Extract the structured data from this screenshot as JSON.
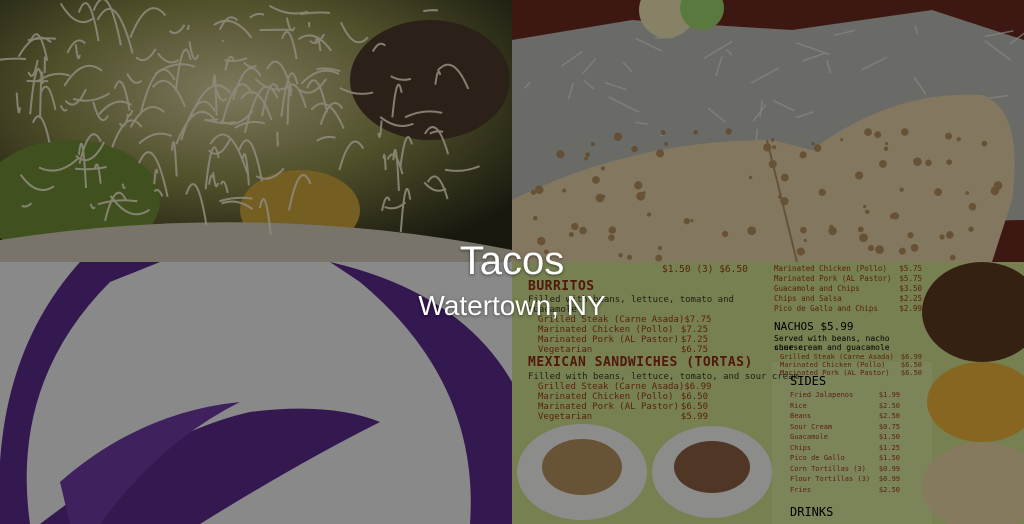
{
  "hero": {
    "title": "Tacos",
    "subtitle": "Watertown, NY"
  },
  "images": [
    {
      "name": "taco-salad-photo"
    },
    {
      "name": "burrito-foil-photo"
    },
    {
      "name": "taco-bell-logo-photo"
    },
    {
      "name": "menu-board-photo"
    }
  ],
  "menu": {
    "top_line": {
      "label": "",
      "price": "$1.50   (3) $6.50"
    },
    "burritos": {
      "heading": "BURRITOS",
      "desc": "Filled with beans, lettuce, tomato and",
      "desc2": "guacamole",
      "items": [
        {
          "label": "Grilled Steak (Carne Asada)",
          "price": "$7.75"
        },
        {
          "label": "Marinated Chicken (Pollo)",
          "price": "$7.25"
        },
        {
          "label": "Marinated Pork (AL Pastor)",
          "price": "$7.25"
        },
        {
          "label": "Vegetarian",
          "price": "$6.75"
        }
      ]
    },
    "tortas": {
      "heading": "MEXICAN SANDWICHES (TORTAS)",
      "desc": "Filled with beans, lettuce, tomato, and sour cream",
      "items": [
        {
          "label": "Grilled Steak (Carne Asada)",
          "price": "$6.99"
        },
        {
          "label": "Marinated Chicken (Pollo)",
          "price": "$6.50"
        },
        {
          "label": "Marinated Pork (AL Pastor)",
          "price": "$6.50"
        },
        {
          "label": "Vegetarian",
          "price": "$5.99"
        }
      ]
    },
    "right_top": [
      {
        "label": "Marinated Chicken (Pollo)",
        "price": "$5.75"
      },
      {
        "label": "Marinated Pork (AL Pastor)",
        "price": "$5.75"
      },
      {
        "label": "Guacamole and Chips",
        "price": "$3.50"
      },
      {
        "label": "Chips and Salsa",
        "price": "$2.25"
      },
      {
        "label": "Pico de Gallo and Chips",
        "price": "$2.99"
      }
    ],
    "nachos": {
      "heading": "NACHOS $5.99",
      "desc": "Served with beans, nacho cheese,",
      "desc2": "sour cream and guacamole",
      "items": [
        {
          "label": "Grilled Steak (Carne Asada)",
          "price": "$6.99"
        },
        {
          "label": "Marinated Chicken (Pollo)",
          "price": "$6.50"
        },
        {
          "label": "Marinated Pork (AL Pastor)",
          "price": "$6.50"
        }
      ]
    },
    "sides": {
      "heading": "SIDES",
      "items": [
        {
          "label": "Fried Jalapenos",
          "price": "$1.99"
        },
        {
          "label": "Rice",
          "price": "$2.50"
        },
        {
          "label": "Beans",
          "price": "$2.50"
        },
        {
          "label": "Sour Cream",
          "price": "$0.75"
        },
        {
          "label": "Guacamole",
          "price": "$1.50"
        },
        {
          "label": "Chips",
          "price": "$1.25"
        },
        {
          "label": "Pico de Gallo",
          "price": "$1.50"
        },
        {
          "label": "Corn Tortillas (3)",
          "price": "$0.99"
        },
        {
          "label": "Flour Tortillas (3)",
          "price": "$0.99"
        },
        {
          "label": "Fries",
          "price": "$2.50"
        }
      ]
    },
    "drinks": {
      "heading": "DRINKS"
    }
  }
}
